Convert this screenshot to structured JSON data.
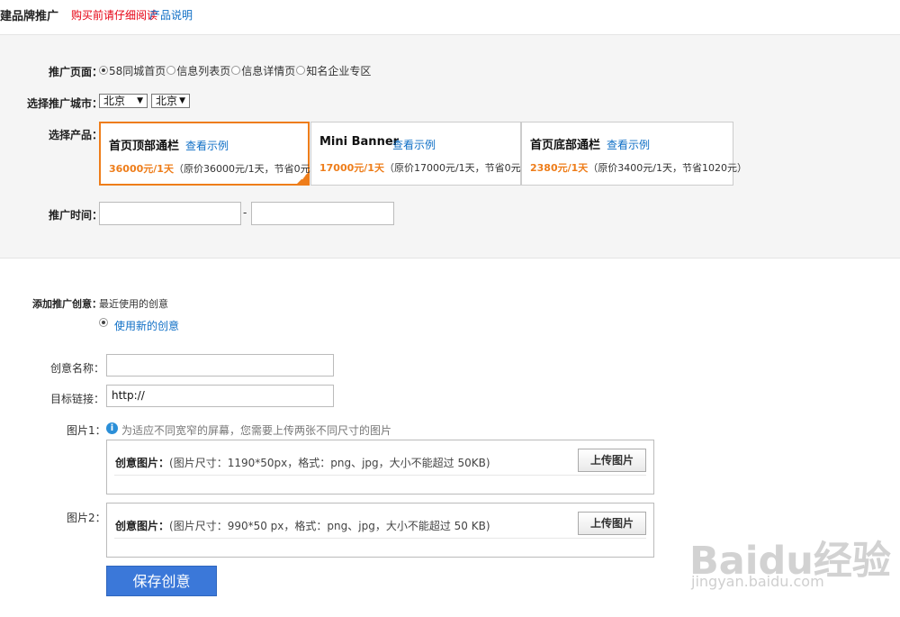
{
  "header": {
    "title": "建品牌推广",
    "notice": "购买前请仔细阅读",
    "explain_link": "产品说明"
  },
  "promo_page": {
    "label": "推广页面：",
    "options": [
      {
        "label": "58同城首页",
        "selected": true
      },
      {
        "label": "信息列表页",
        "selected": false
      },
      {
        "label": "信息详情页",
        "selected": false
      },
      {
        "label": "知名企业专区",
        "selected": false
      }
    ]
  },
  "city": {
    "label": "选择推广城市：",
    "province": "北京",
    "city": "北京"
  },
  "products": {
    "label": "选择产品：",
    "items": [
      {
        "name": "首页顶部通栏",
        "example": "查看示例",
        "price": "36000元/1天",
        "detail": "（原价36000元/1天，节省0元）",
        "selected": true
      },
      {
        "name": "Mini Banner",
        "example": "查看示例",
        "price": "17000元/1天",
        "detail": "（原价17000元/1天，节省0元）",
        "selected": false
      },
      {
        "name": "首页底部通栏",
        "example": "查看示例",
        "price": "2380元/1天",
        "detail": "（原价3400元/1天，节省1020元）",
        "selected": false
      }
    ]
  },
  "promo_time": {
    "label": "推广时间：",
    "start": "",
    "end": "",
    "separator": "-"
  },
  "creative": {
    "label": "添加推广创意：",
    "recent": "最近使用的创意",
    "use_new": "使用新的创意",
    "name_label": "创意名称：",
    "name_value": "",
    "link_label": "目标链接：",
    "link_value": "http://",
    "image1_label": "图片1：",
    "image1_hint": "为适应不同宽窄的屏幕，您需要上传两张不同尺寸的图片",
    "image1_title": "创意图片：",
    "image1_spec": "(图片尺寸：1190*50px，格式：png、jpg，大小不能超过 50KB)",
    "image2_label": "图片2：",
    "image2_title": "创意图片：",
    "image2_spec": "(图片尺寸：990*50 px，格式：png、jpg，大小不能超过 50 KB)",
    "upload_label": "上传图片",
    "save_label": "保存创意"
  },
  "watermark": {
    "logo": "Baidu经验",
    "url": "jingyan.baidu.com"
  },
  "colors": {
    "accent": "#ee7d1a",
    "link": "#0f6fc6",
    "notice": "#e60012",
    "button": "#3b78d9"
  }
}
